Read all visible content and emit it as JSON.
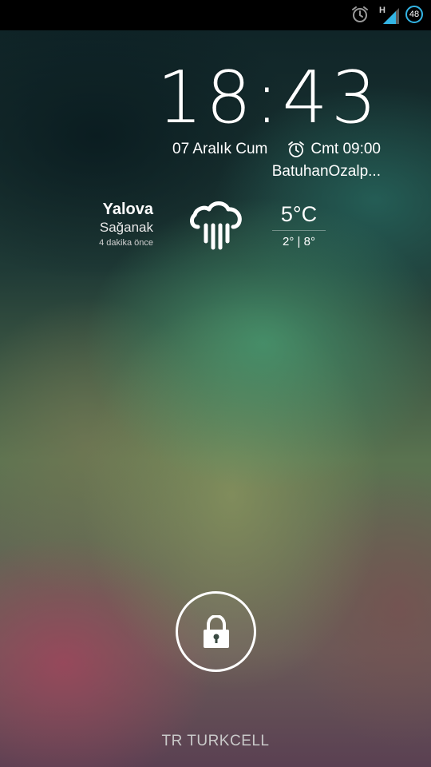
{
  "status_bar": {
    "alarm_icon": "alarm-clock-icon",
    "network_type": "H",
    "signal_icon": "signal-strength-icon",
    "battery_level": "48",
    "battery_color": "#33b5e5"
  },
  "clock": {
    "time": "18:43"
  },
  "date_row": {
    "date": "07 Aralık Cum",
    "alarm_icon": "alarm-clock-icon",
    "next_alarm": "Cmt 09:00"
  },
  "owner_info": "BatuhanOzalp...",
  "weather": {
    "city": "Yalova",
    "condition": "Sağanak",
    "updated": "4 dakika önce",
    "icon": "rain-cloud-icon",
    "temperature": "5°C",
    "range": "2° | 8°"
  },
  "unlock": {
    "icon": "lock-icon"
  },
  "carrier": "TR TURKCELL"
}
